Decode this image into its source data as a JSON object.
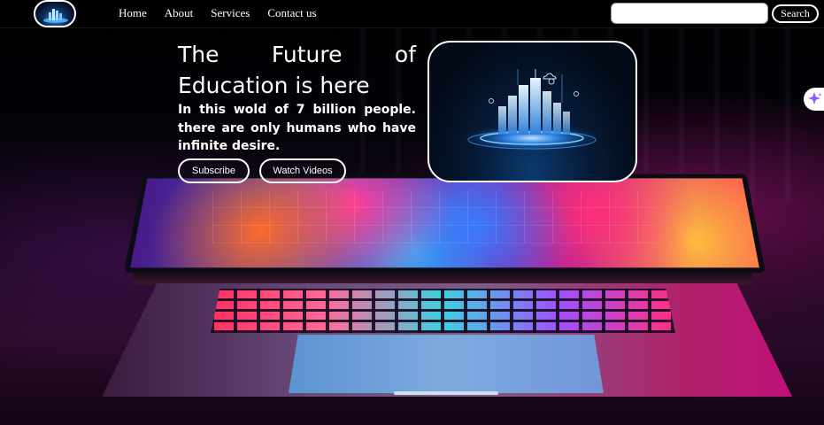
{
  "nav": {
    "logo_icon": "city-hologram-logo",
    "links": [
      {
        "label": "Home"
      },
      {
        "label": "About"
      },
      {
        "label": "Services"
      },
      {
        "label": "Contact us"
      }
    ],
    "search": {
      "placeholder": "",
      "value": "",
      "button_label": "Search"
    }
  },
  "hero": {
    "title": "The Future of Education is here",
    "subtitle": "In this wold of 7 billion people. there are only humans who have infinite desire.",
    "buttons": {
      "subscribe": "Subscribe",
      "watch": "Watch Videos"
    },
    "image_icon": "futuristic-city-hologram"
  },
  "side_widget": {
    "icon": "sparkle-icon",
    "color": "#8a5cf5"
  },
  "colors": {
    "accent": "#ffffff",
    "background": "#000000",
    "glow": "#2f8cff"
  }
}
